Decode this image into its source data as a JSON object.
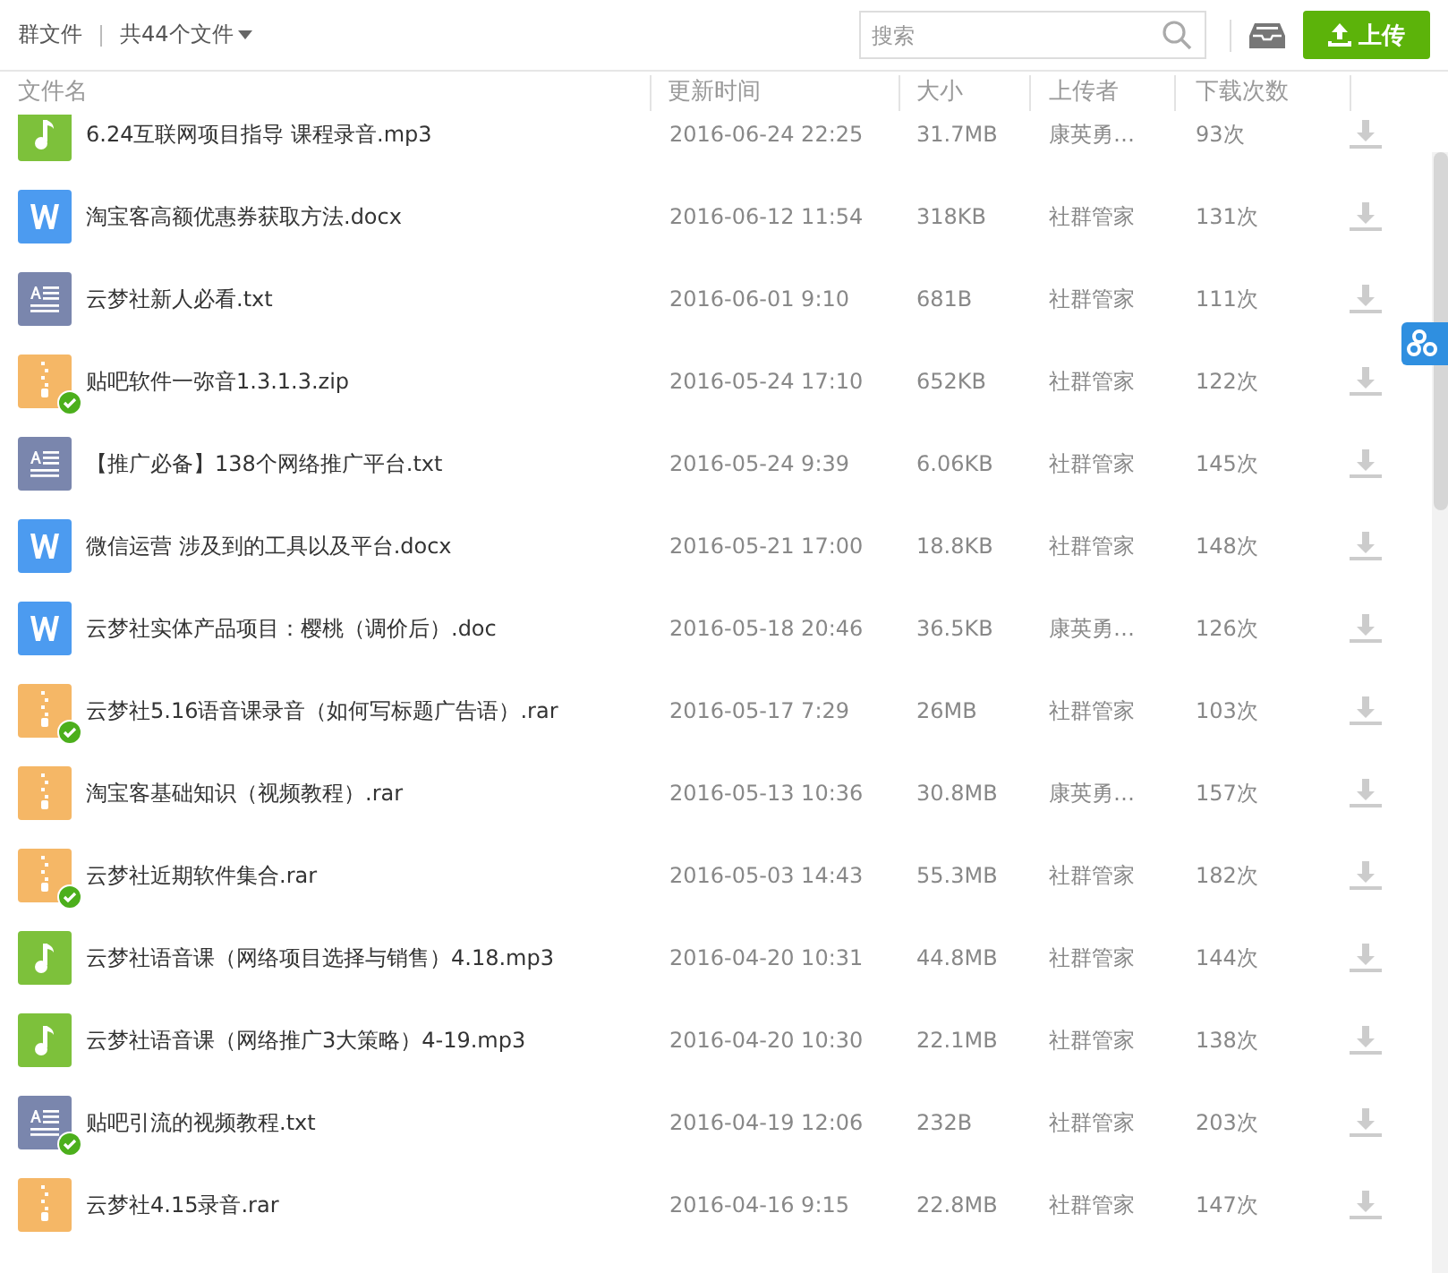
{
  "toolbar": {
    "title": "群文件",
    "count": "共44个文件",
    "search": {
      "placeholder": "搜索"
    },
    "upload": "上传"
  },
  "columns": [
    "文件名",
    "更新时间",
    "大小",
    "上传者",
    "下载次数"
  ],
  "files": [
    {
      "kind": "audio",
      "name": "6.24互联网项目指导 课程录音.mp3",
      "time": "2016-06-24 22:25",
      "size": "31.7MB",
      "uploader": "康英勇…",
      "downloads": "93次",
      "synced": false
    },
    {
      "kind": "word",
      "name": "淘宝客高额优惠券获取方法.docx",
      "time": "2016-06-12 11:54",
      "size": "318KB",
      "uploader": "社群管家",
      "downloads": "131次",
      "synced": false
    },
    {
      "kind": "text",
      "name": "云梦社新人必看.txt",
      "time": "2016-06-01 9:10",
      "size": "681B",
      "uploader": "社群管家",
      "downloads": "111次",
      "synced": false
    },
    {
      "kind": "archive",
      "name": "贴吧软件一弥音1.3.1.3.zip",
      "time": "2016-05-24 17:10",
      "size": "652KB",
      "uploader": "社群管家",
      "downloads": "122次",
      "synced": true
    },
    {
      "kind": "text",
      "name": "【推广必备】138个网络推广平台.txt",
      "time": "2016-05-24 9:39",
      "size": "6.06KB",
      "uploader": "社群管家",
      "downloads": "145次",
      "synced": false
    },
    {
      "kind": "word",
      "name": "微信运营 涉及到的工具以及平台.docx",
      "time": "2016-05-21 17:00",
      "size": "18.8KB",
      "uploader": "社群管家",
      "downloads": "148次",
      "synced": false
    },
    {
      "kind": "word",
      "name": "云梦社实体产品项目：樱桃（调价后）.doc",
      "time": "2016-05-18 20:46",
      "size": "36.5KB",
      "uploader": "康英勇…",
      "downloads": "126次",
      "synced": false
    },
    {
      "kind": "archive",
      "name": "云梦社5.16语音课录音（如何写标题广告语）.rar",
      "time": "2016-05-17 7:29",
      "size": "26MB",
      "uploader": "社群管家",
      "downloads": "103次",
      "synced": true
    },
    {
      "kind": "archive",
      "name": "淘宝客基础知识（视频教程）.rar",
      "time": "2016-05-13 10:36",
      "size": "30.8MB",
      "uploader": "康英勇…",
      "downloads": "157次",
      "synced": false
    },
    {
      "kind": "archive",
      "name": "云梦社近期软件集合.rar",
      "time": "2016-05-03 14:43",
      "size": "55.3MB",
      "uploader": "社群管家",
      "downloads": "182次",
      "synced": true
    },
    {
      "kind": "audio",
      "name": "云梦社语音课（网络项目选择与销售）4.18.mp3",
      "time": "2016-04-20 10:31",
      "size": "44.8MB",
      "uploader": "社群管家",
      "downloads": "144次",
      "synced": false
    },
    {
      "kind": "audio",
      "name": "云梦社语音课（网络推广3大策略）4-19.mp3",
      "time": "2016-04-20 10:30",
      "size": "22.1MB",
      "uploader": "社群管家",
      "downloads": "138次",
      "synced": false
    },
    {
      "kind": "text",
      "name": "贴吧引流的视频教程.txt",
      "time": "2016-04-19 12:06",
      "size": "232B",
      "uploader": "社群管家",
      "downloads": "203次",
      "synced": true
    },
    {
      "kind": "archive",
      "name": "云梦社4.15录音.rar",
      "time": "2016-04-16 9:15",
      "size": "22.8MB",
      "uploader": "社群管家",
      "downloads": "147次",
      "synced": false
    }
  ]
}
